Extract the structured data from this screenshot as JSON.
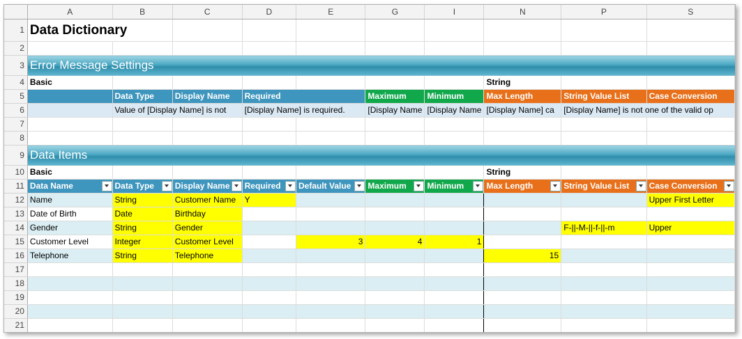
{
  "columns": [
    "A",
    "B",
    "C",
    "D",
    "E",
    "G",
    "I",
    "N",
    "P",
    "S"
  ],
  "title": "Data Dictionary",
  "sections": {
    "error_settings": "Error Message Settings",
    "data_items": "Data Items"
  },
  "group_labels": {
    "basic": "Basic",
    "string": "String"
  },
  "error_header": {
    "data_type": "Data Type",
    "display_name": "Display Name",
    "required": "Required",
    "maximum": "Maximum",
    "minimum": "Minimum",
    "max_length": "Max Length",
    "string_value_list": "String Value List",
    "case_conversion": "Case Conversion"
  },
  "error_messages": {
    "data_type": "Value of [Display Name] is not",
    "display_name": "",
    "required": "[Display Name] is required.",
    "maximum": "[Display Name",
    "minimum": "[Display Name",
    "max_length": "[Display Name] ca",
    "string_value_list": "[Display Name] is not one of the valid op"
  },
  "items_header": {
    "data_name": "Data Name",
    "data_type": "Data Type",
    "display_name": "Display Name",
    "required": "Required",
    "default_value": "Default Value",
    "maximum": "Maximum",
    "minimum": "Minimum",
    "max_length": "Max Length",
    "string_value_list": "String Value List",
    "case_conversion": "Case Conversion"
  },
  "items": [
    {
      "name": "Name",
      "type": "String",
      "display": "Customer Name",
      "required": "Y",
      "default": "",
      "max": "",
      "min": "",
      "maxlen": "",
      "list": "",
      "case": "Upper First Letter"
    },
    {
      "name": "Date of Birth",
      "type": "Date",
      "display": "Birthday",
      "required": "",
      "default": "",
      "max": "",
      "min": "",
      "maxlen": "",
      "list": "",
      "case": ""
    },
    {
      "name": "Gender",
      "type": "String",
      "display": "Gender",
      "required": "",
      "default": "",
      "max": "",
      "min": "",
      "maxlen": "",
      "list": "F-||-M-||-f-||-m",
      "case": "Upper"
    },
    {
      "name": "Customer Level",
      "type": "Integer",
      "display": "Customer Level",
      "required": "",
      "default": "3",
      "max": "4",
      "min": "1",
      "maxlen": "",
      "list": "",
      "case": ""
    },
    {
      "name": "Telephone",
      "type": "String",
      "display": "Telephone",
      "required": "",
      "default": "",
      "max": "",
      "min": "",
      "maxlen": "15",
      "list": "",
      "case": ""
    }
  ],
  "row_numbers": [
    "1",
    "2",
    "3",
    "4",
    "5",
    "6",
    "7",
    "8",
    "9",
    "10",
    "11",
    "12",
    "13",
    "14",
    "15",
    "16",
    "17",
    "18",
    "19",
    "20",
    "21"
  ]
}
